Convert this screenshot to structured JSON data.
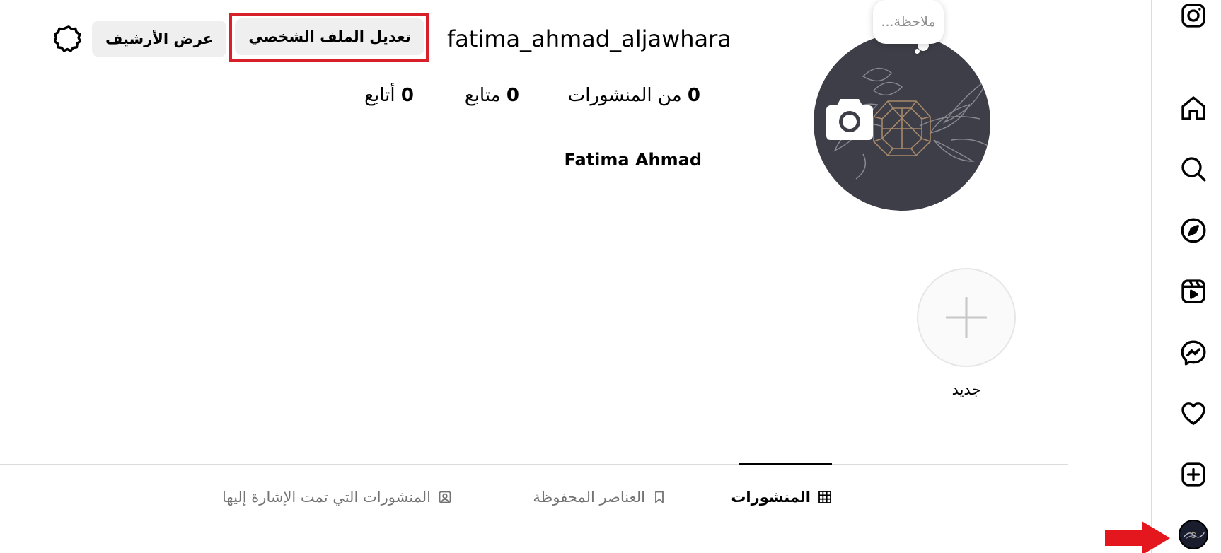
{
  "profile": {
    "username": "fatima_ahmad_aljawhara",
    "display_name": "Fatima Ahmad",
    "note_placeholder": "ملاحظة...",
    "edit_profile_label": "تعديل الملف الشخصي",
    "view_archive_label": "عرض الأرشيف"
  },
  "stats": {
    "posts_count": "0",
    "posts_label": "من المنشورات",
    "followers_count": "0",
    "followers_label": "متابع",
    "following_count": "0",
    "following_label": "أتابع"
  },
  "highlights": {
    "new_label": "جديد"
  },
  "tabs": [
    {
      "label": "المنشورات",
      "icon": "grid-icon",
      "active": true
    },
    {
      "label": "العناصر المحفوظة",
      "icon": "bookmark-icon",
      "active": false
    },
    {
      "label": "المنشورات التي تمت الإشارة إليها",
      "icon": "tagged-icon",
      "active": false
    }
  ],
  "sidebar": {
    "items": [
      "instagram-icon",
      "home-icon",
      "search-icon",
      "explore-icon",
      "reels-icon",
      "messenger-icon",
      "notifications-icon",
      "create-icon",
      "profile-avatar"
    ]
  },
  "colors": {
    "highlight_border": "#d8202a",
    "button_bg": "#efefef",
    "profile_bg": "#3d3e47"
  }
}
